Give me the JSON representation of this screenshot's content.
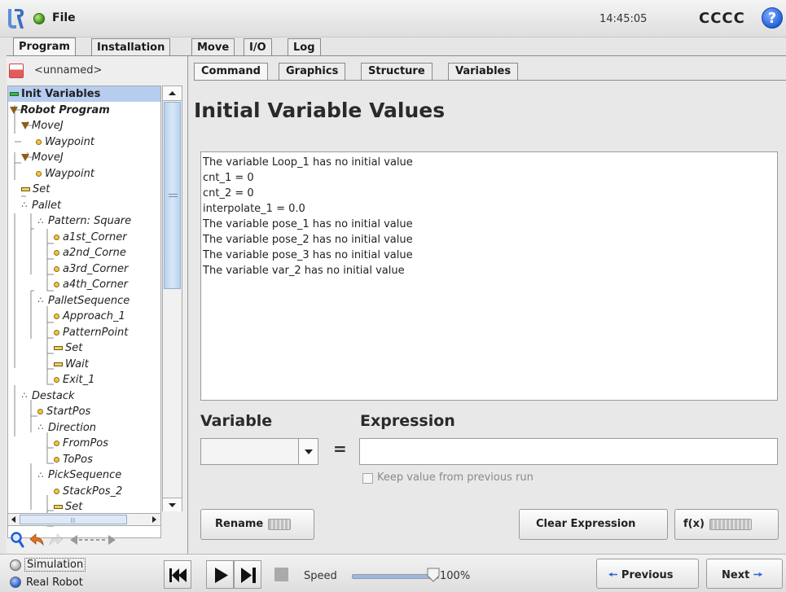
{
  "topbar": {
    "file_label": "File",
    "clock": "14:45:05",
    "robot_name": "CCCC",
    "help_glyph": "?"
  },
  "main_tabs": [
    "Program",
    "Installation",
    "Move",
    "I/O",
    "Log"
  ],
  "program": {
    "name": "<unnamed>"
  },
  "tree": [
    {
      "label": "Init Variables",
      "icon": "init-variables-icon",
      "selected": true
    },
    {
      "label": "Robot Program",
      "icon": "program-triangle-icon",
      "bold": true
    },
    {
      "label": "MoveJ",
      "icon": "move-triangle-icon"
    },
    {
      "label": "Waypoint",
      "icon": "waypoint-dot-icon"
    },
    {
      "label": "MoveJ",
      "icon": "move-triangle-icon"
    },
    {
      "label": "Waypoint",
      "icon": "waypoint-dot-icon"
    },
    {
      "label": "Set",
      "icon": "set-icon"
    },
    {
      "label": "Pallet",
      "icon": "pallet-icon"
    },
    {
      "label": "Pattern: Square",
      "icon": "pallet-icon"
    },
    {
      "label": "a1st_Corner",
      "icon": "waypoint-dot-icon"
    },
    {
      "label": "a2nd_Corne",
      "icon": "waypoint-dot-icon"
    },
    {
      "label": "a3rd_Corner",
      "icon": "waypoint-dot-icon"
    },
    {
      "label": "a4th_Corner",
      "icon": "waypoint-dot-icon"
    },
    {
      "label": "PalletSequence",
      "icon": "pallet-icon"
    },
    {
      "label": "Approach_1",
      "icon": "waypoint-dot-icon"
    },
    {
      "label": "PatternPoint",
      "icon": "waypoint-dot-icon"
    },
    {
      "label": "Set",
      "icon": "set-icon"
    },
    {
      "label": "Wait",
      "icon": "set-icon"
    },
    {
      "label": "Exit_1",
      "icon": "waypoint-dot-icon"
    },
    {
      "label": "Destack",
      "icon": "pallet-icon"
    },
    {
      "label": "StartPos",
      "icon": "waypoint-dot-icon"
    },
    {
      "label": "Direction",
      "icon": "pallet-icon"
    },
    {
      "label": "FromPos",
      "icon": "waypoint-dot-icon"
    },
    {
      "label": "ToPos",
      "icon": "waypoint-dot-icon"
    },
    {
      "label": "PickSequence",
      "icon": "pallet-icon"
    },
    {
      "label": "StackPos_2",
      "icon": "waypoint-dot-icon"
    },
    {
      "label": "Set",
      "icon": "set-icon"
    }
  ],
  "sub_tabs": [
    "Command",
    "Graphics",
    "Structure",
    "Variables"
  ],
  "command": {
    "title": "Initial Variable Values",
    "variable_lines": [
      "The variable Loop_1 has no initial value",
      "cnt_1 = 0",
      "cnt_2 = 0",
      "interpolate_1 = 0.0",
      "The variable pose_1 has no initial value",
      "The variable pose_2 has no initial value",
      "The variable pose_3 has no initial value",
      "The variable var_2 has no initial value"
    ],
    "variable_label": "Variable",
    "expression_label": "Expression",
    "equals": "=",
    "variable_value": "",
    "expression_value": "",
    "keep_value_label": "Keep value from previous run",
    "rename_label": "Rename",
    "clear_expression_label": "Clear Expression",
    "fx_label": "f(x)"
  },
  "bottombar": {
    "simulation_label": "Simulation",
    "real_robot_label": "Real Robot",
    "speed_label": "Speed",
    "speed_value": "100%",
    "speed_fraction": 1.0,
    "previous_label": "Previous",
    "next_label": "Next"
  },
  "colors": {
    "selection": "#b6cdf0",
    "accent_blue": "#2e67d6",
    "status_green": "#3d8a15"
  }
}
